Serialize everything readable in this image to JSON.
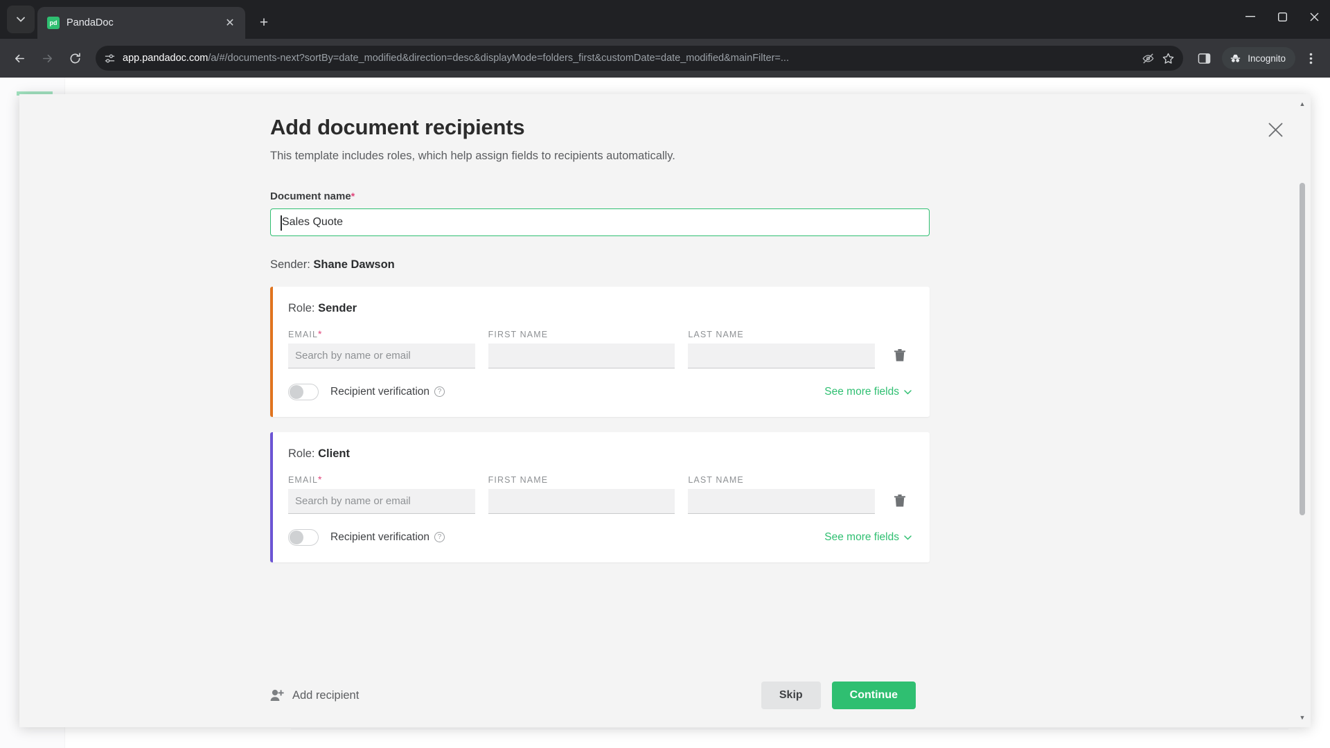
{
  "browser": {
    "tab": {
      "title": "PandaDoc",
      "favicon_text": "pd",
      "close_icon": "close-icon"
    },
    "new_tab_icon": "plus-icon",
    "tab_search_icon": "chevron-down-icon",
    "window_controls": {
      "minimize": "minimize-icon",
      "maximize": "maximize-icon",
      "close": "close-icon"
    },
    "nav": {
      "back": "back-arrow-icon",
      "forward": "forward-arrow-icon",
      "reload": "reload-icon"
    },
    "omnibox": {
      "site_info_icon": "site-settings-icon",
      "url_host": "app.pandadoc.com",
      "url_rest": "/a/#/documents-next?sortBy=date_modified&direction=desc&displayMode=folders_first&customDate=date_modified&mainFilter=...",
      "tracking_icon": "eye-slash-icon",
      "bookmark_icon": "star-icon"
    },
    "side_panel_icon": "side-panel-icon",
    "incognito_label": "Incognito",
    "incognito_icon": "incognito-icon",
    "menu_icon": "three-dot-menu-icon"
  },
  "modal": {
    "title": "Add document recipients",
    "subtitle": "This template includes roles, which help assign fields to recipients automatically.",
    "close_icon": "close-icon",
    "document_name": {
      "label": "Document name",
      "required_mark": "*",
      "value": "Sales Quote"
    },
    "sender_prefix": "Sender:",
    "sender_name": "Shane Dawson",
    "field_labels": {
      "email": "EMAIL",
      "email_required": "*",
      "first_name": "FIRST NAME",
      "last_name": "LAST NAME"
    },
    "email_placeholder": "Search by name or email",
    "first_name_value": "",
    "last_name_value": "",
    "toggle_label": "Recipient verification",
    "help_icon": "question-mark-icon",
    "see_more_label": "See more fields",
    "see_more_icon": "chevron-down-icon",
    "delete_icon": "trash-icon",
    "roles": [
      {
        "prefix": "Role:",
        "name": "Sender",
        "accent": "#e0741f"
      },
      {
        "prefix": "Role:",
        "name": "Client",
        "accent": "#6c55d4"
      }
    ],
    "footer": {
      "add_recipient_label": "Add recipient",
      "add_recipient_icon": "add-user-icon",
      "skip_label": "Skip",
      "continue_label": "Continue"
    }
  },
  "colors": {
    "primary_green": "#2fbf71",
    "sender_accent": "#e0741f",
    "client_accent": "#6c55d4",
    "required_red": "#e0457b"
  }
}
